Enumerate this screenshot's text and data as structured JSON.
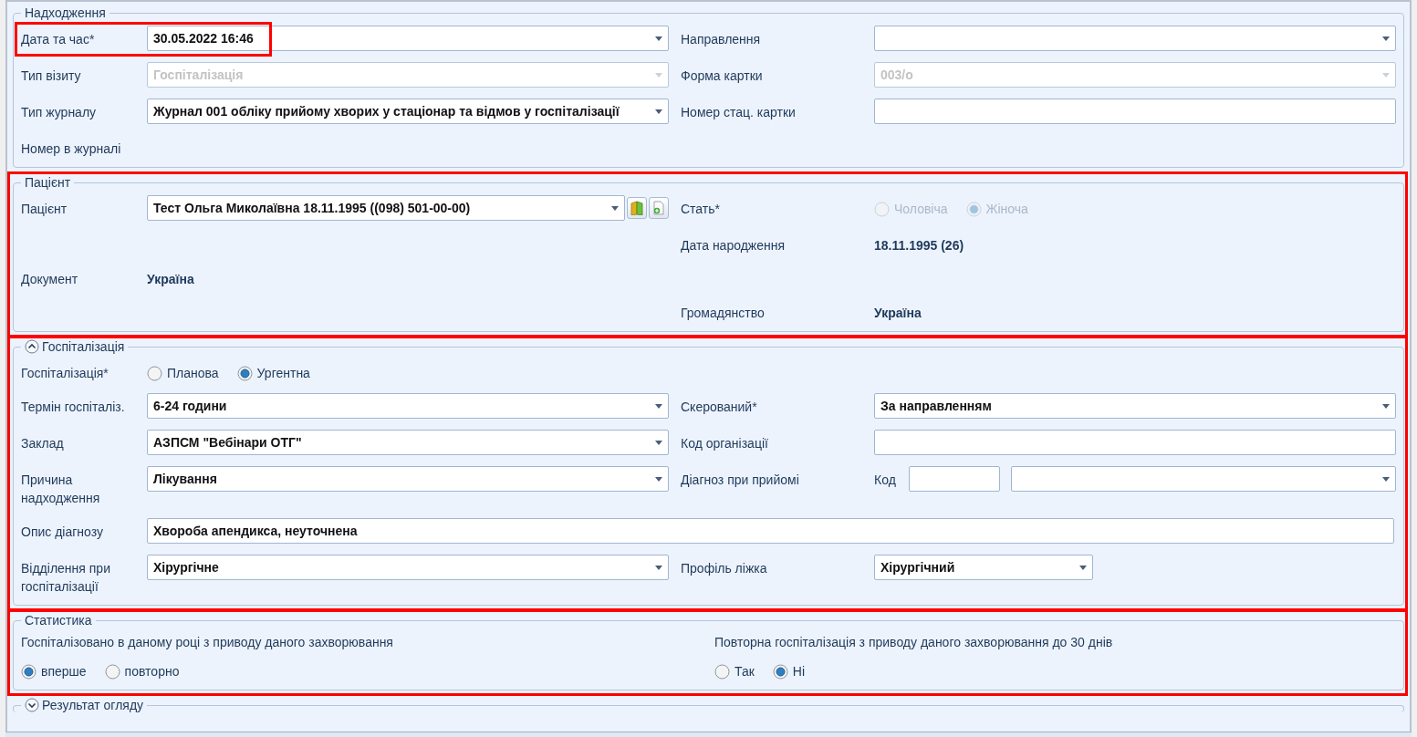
{
  "sections": [
    {
      "title": "Надходження",
      "kind": "fields",
      "rows": [
        {
          "left": {
            "label": "Дата та час*",
            "highlighted": true,
            "field": {
              "kind": "combo",
              "value": "30.05.2022 16:46",
              "disabled": false
            }
          },
          "right": {
            "label": "Направлення",
            "field": {
              "kind": "combo",
              "disabled": false
            }
          }
        },
        {
          "left": {
            "label": "Тип візиту",
            "field": {
              "kind": "combo",
              "value": "Госпіталізація",
              "disabled": true
            }
          },
          "right": {
            "label": "Форма картки",
            "field": {
              "kind": "combo",
              "value": "003/о",
              "disabled": true
            }
          }
        },
        {
          "left": {
            "label": "Тип журналу",
            "field": {
              "kind": "combo",
              "value": "Журнал 001 обліку прийому хворих у стаціонар та відмов у госпіталізації",
              "disabled": false
            }
          },
          "right": {
            "label": "Номер стац. картки",
            "field": {
              "kind": "text"
            }
          }
        },
        {
          "left": {
            "label": "Номер в журналі"
          }
        }
      ]
    },
    {
      "title": "Пацієнт",
      "kind": "fields",
      "highlighted": true,
      "rows": [
        {
          "left": {
            "label": "Пацієнт",
            "field": {
              "kind": "patient",
              "value": "Тест Ольга Миколаївна 18.11.1995 ((098) 501-00-00)"
            }
          },
          "right": {
            "label": "Стать*",
            "field": {
              "kind": "radios",
              "disabled": true,
              "options": [
                {
                  "label": "Чоловіча",
                  "selected": false
                },
                {
                  "label": "Жіноча",
                  "selected": true
                }
              ]
            }
          }
        },
        {
          "right": {
            "label": "Дата народження",
            "field": {
              "kind": "value",
              "value": "18.11.1995 (26)"
            }
          }
        },
        {
          "left": {
            "label": "Документ",
            "field": {
              "kind": "value",
              "value": "Україна"
            }
          }
        },
        {
          "right": {
            "label": "Громадянство",
            "field": {
              "kind": "value",
              "value": "Україна"
            }
          }
        }
      ]
    },
    {
      "title": "Госпіталізація",
      "kind": "fields",
      "highlighted": true,
      "expanded": true,
      "rows": [
        {
          "left": {
            "label": "Госпіталізація*",
            "field": {
              "kind": "radios",
              "disabled": false,
              "options": [
                {
                  "label": "Планова",
                  "selected": false
                },
                {
                  "label": "Ургентна",
                  "selected": true
                }
              ]
            }
          }
        },
        {
          "left": {
            "label": "Термін госпіталіз.",
            "field": {
              "kind": "combo",
              "value": "6-24 години",
              "disabled": false
            }
          },
          "right": {
            "label": "Скерований*",
            "field": {
              "kind": "combo",
              "value": "За направленням",
              "disabled": false
            }
          }
        },
        {
          "left": {
            "label": "Заклад",
            "field": {
              "kind": "combo",
              "value": "АЗПСМ \"Вебінари ОТГ\"",
              "disabled": false
            }
          },
          "right": {
            "label": "Код організації",
            "field": {
              "kind": "text"
            }
          }
        },
        {
          "left": {
            "label": "Причина надходження",
            "field": {
              "kind": "combo",
              "value": "Лікування",
              "disabled": false
            }
          },
          "right": {
            "label": "Діагноз при прийомі",
            "field": {
              "kind": "code",
              "code_label": "Код"
            }
          }
        },
        {
          "full": {
            "label": "Опис діагнозу",
            "field": {
              "kind": "text",
              "value": "Хвороба апендикса, неуточнена"
            }
          }
        },
        {
          "left": {
            "label": "Відділення при госпіталізації",
            "field": {
              "kind": "combo",
              "value": "Хірургічне",
              "disabled": false
            }
          },
          "right": {
            "label": "Профіль ліжка",
            "field": {
              "kind": "combo",
              "value": "Хірургічний",
              "disabled": false,
              "compact": true
            }
          }
        }
      ]
    },
    {
      "title": "Статистика",
      "kind": "questions",
      "highlighted": true,
      "questions": [
        {
          "question": "Госпіталізовано в даному році з приводу даного захворювання",
          "options": [
            {
              "label": "вперше",
              "selected": true
            },
            {
              "label": "повторно",
              "selected": false
            }
          ]
        },
        {
          "question": "Повторна госпіталізація з приводу даного захворювання до 30 днів",
          "options": [
            {
              "label": "Так",
              "selected": false
            },
            {
              "label": "Ні",
              "selected": true
            }
          ]
        }
      ]
    },
    {
      "title": "Результат огляду",
      "kind": "collapsed",
      "expanded": false
    }
  ]
}
